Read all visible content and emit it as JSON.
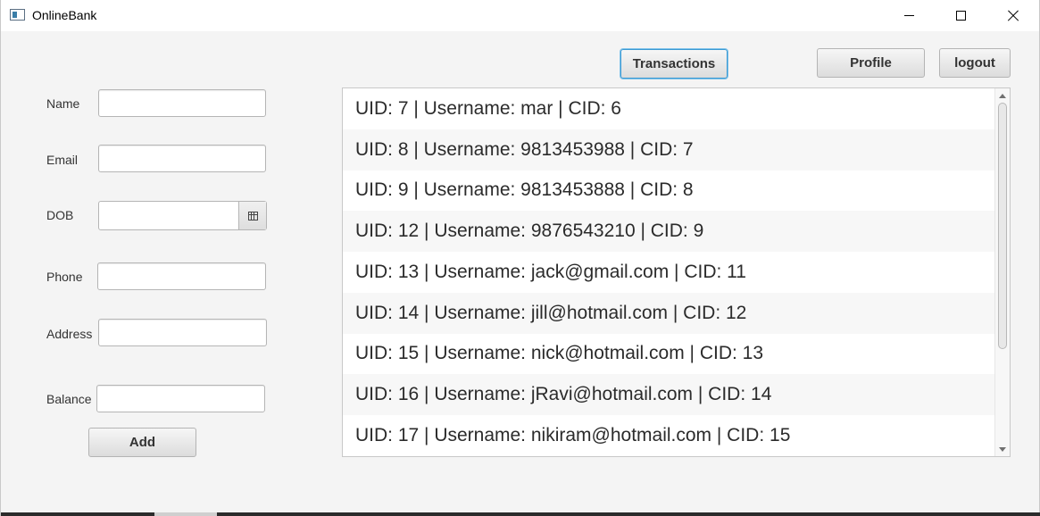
{
  "window": {
    "title": "OnlineBank",
    "controls": [
      "minimize-icon",
      "maximize-icon",
      "close-icon"
    ]
  },
  "form": {
    "name_label": "Name",
    "name_value": "",
    "email_label": "Email",
    "email_value": "",
    "dob_label": "DOB",
    "dob_value": "",
    "phone_label": "Phone",
    "phone_value": "",
    "address_label": "Address",
    "address_value": "",
    "balance_label": "Balance",
    "balance_value": "",
    "add_button": "Add"
  },
  "toolbar": {
    "transactions_button": "Transactions",
    "profile_button": "Profile",
    "logout_button": "logout"
  },
  "user_list": [
    "UID: 7 | Username: mar | CID: 6",
    "UID: 8 | Username: 9813453988 | CID: 7",
    "UID: 9 | Username: 9813453888 | CID: 8",
    "UID: 12 | Username: 9876543210 | CID: 9",
    "UID: 13 | Username: jack@gmail.com | CID: 11",
    "UID: 14 | Username: jill@hotmail.com | CID: 12",
    "UID: 15 | Username: nick@hotmail.com | CID: 13",
    "UID: 16 | Username: jRavi@hotmail.com | CID: 14",
    "UID: 17 | Username: nikiram@hotmail.com | CID: 15"
  ],
  "colors": {
    "focus_border": "#3b99d3",
    "window_background": "#f4f4f4"
  }
}
